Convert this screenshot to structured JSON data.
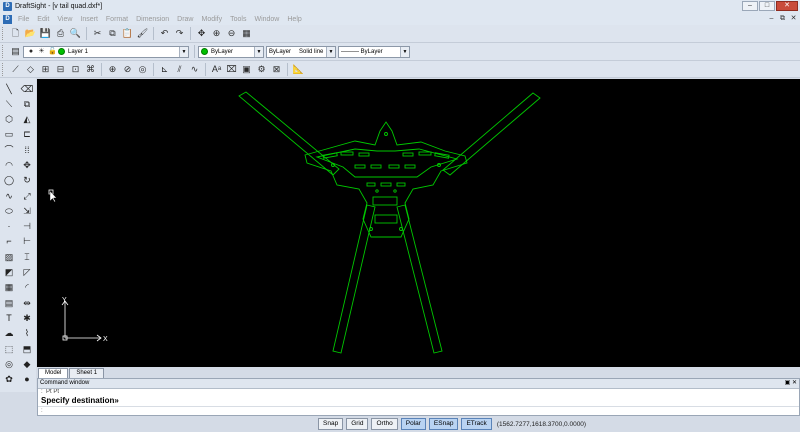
{
  "window": {
    "title": "DraftSight - [v tail quad.dxf*]",
    "app_icon_glyph": "D",
    "buttons": [
      "–",
      "□",
      "✕"
    ]
  },
  "menu": {
    "items": [
      "File",
      "Edit",
      "View",
      "Insert",
      "Format",
      "Dimension",
      "Draw",
      "Modify",
      "Tools",
      "Window",
      "Help"
    ],
    "doc_buttons": [
      "–",
      "⧉",
      "✕"
    ]
  },
  "toolbar1": {
    "icons": [
      "new-icon",
      "open-icon",
      "save-icon",
      "print-icon",
      "print-preview-icon",
      "cut-icon",
      "copy-icon",
      "paste-icon",
      "match-properties-icon",
      "undo-icon",
      "redo-icon",
      "pan-icon",
      "zoom-window-icon",
      "zoom-previous-icon",
      "properties-icon"
    ]
  },
  "toolbar2": {
    "layer_value": "Layer 1",
    "color_value": "ByLayer",
    "linestyle_value": "ByLayer",
    "linestyle_name": "Solid line",
    "lineweight_value": "——— ByLayer"
  },
  "canvas": {
    "background": "#000000",
    "stroke": "#00c800",
    "ucs_x_label": "X",
    "ucs_y_label": "Y"
  },
  "tabs": [
    {
      "label": "Model",
      "active": true
    },
    {
      "label": "Sheet 1",
      "active": false
    }
  ],
  "command": {
    "header": "Command window",
    "header_controls": "▣ ✕",
    "prev_line": ":  Pt Pt ",
    "prompt": "Specify destination»",
    "input": ":"
  },
  "status": {
    "buttons": [
      {
        "label": "Snap",
        "on": false
      },
      {
        "label": "Grid",
        "on": false
      },
      {
        "label": "Ortho",
        "on": false
      },
      {
        "label": "Polar",
        "on": true
      },
      {
        "label": "ESnap",
        "on": true
      },
      {
        "label": "ETrack",
        "on": true
      }
    ],
    "coordinates": "(1562.7277,1618.3700,0.0000)"
  }
}
